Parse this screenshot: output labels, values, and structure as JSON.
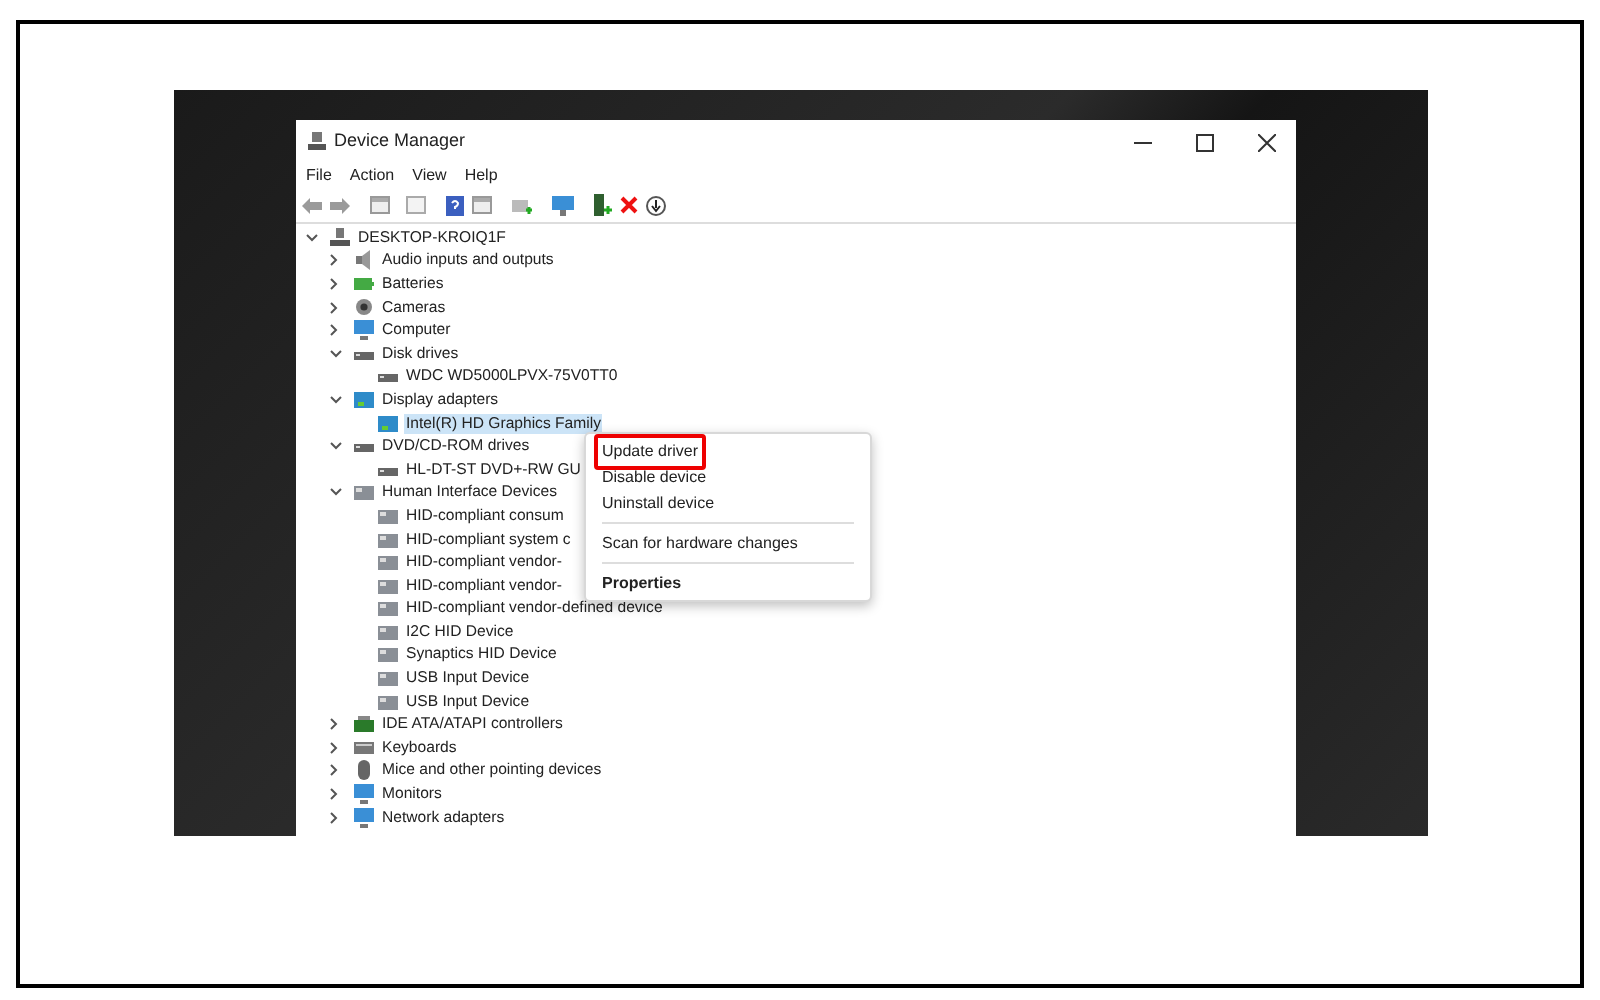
{
  "window": {
    "title": "Device Manager"
  },
  "menu_bar": [
    "File",
    "Action",
    "View",
    "Help"
  ],
  "tree": [
    {
      "label": "DESKTOP-KROIQ1F",
      "kind": "computer",
      "expanded": true,
      "selected": false,
      "children": [
        {
          "label": "Audio inputs and outputs",
          "kind": "audio",
          "expanded": false,
          "selected": false
        },
        {
          "label": "Batteries",
          "kind": "battery",
          "expanded": false,
          "selected": false
        },
        {
          "label": "Cameras",
          "kind": "camera",
          "expanded": false,
          "selected": false
        },
        {
          "label": "Computer",
          "kind": "monitor",
          "expanded": false,
          "selected": false
        },
        {
          "label": "Disk drives",
          "kind": "disk",
          "expanded": true,
          "selected": false,
          "children": [
            {
              "label": "WDC WD5000LPVX-75V0TT0",
              "kind": "disk",
              "selected": false
            }
          ]
        },
        {
          "label": "Display adapters",
          "kind": "display",
          "expanded": true,
          "selected": false,
          "children": [
            {
              "label": "Intel(R) HD Graphics Family",
              "kind": "display",
              "selected": true
            }
          ]
        },
        {
          "label": "DVD/CD-ROM drives",
          "kind": "disk",
          "expanded": true,
          "selected": false,
          "children": [
            {
              "label": "HL-DT-ST DVD+-RW GU",
              "kind": "disk",
              "selected": false
            }
          ]
        },
        {
          "label": "Human Interface Devices",
          "kind": "hid",
          "expanded": true,
          "selected": false,
          "children": [
            {
              "label": "HID-compliant consum",
              "kind": "hid",
              "selected": false
            },
            {
              "label": "HID-compliant system c",
              "kind": "hid",
              "selected": false
            },
            {
              "label": "HID-compliant vendor-",
              "kind": "hid",
              "selected": false
            },
            {
              "label": "HID-compliant vendor-",
              "kind": "hid",
              "selected": false
            },
            {
              "label": "HID-compliant vendor-defined device",
              "kind": "hid",
              "selected": false
            },
            {
              "label": "I2C HID Device",
              "kind": "hid",
              "selected": false
            },
            {
              "label": "Synaptics HID Device",
              "kind": "hid",
              "selected": false
            },
            {
              "label": "USB Input Device",
              "kind": "hid",
              "selected": false
            },
            {
              "label": "USB Input Device",
              "kind": "hid",
              "selected": false
            }
          ]
        },
        {
          "label": "IDE ATA/ATAPI controllers",
          "kind": "ide",
          "expanded": false,
          "selected": false
        },
        {
          "label": "Keyboards",
          "kind": "keyboard",
          "expanded": false,
          "selected": false
        },
        {
          "label": "Mice and other pointing devices",
          "kind": "mouse",
          "expanded": false,
          "selected": false
        },
        {
          "label": "Monitors",
          "kind": "monitor",
          "expanded": false,
          "selected": false
        },
        {
          "label": "Network adapters",
          "kind": "monitor",
          "expanded": false,
          "selected": false
        }
      ]
    }
  ],
  "context_menu": [
    {
      "label": "Update driver",
      "kind": "item",
      "highlighted": true
    },
    {
      "label": "Disable device",
      "kind": "item",
      "highlighted": false
    },
    {
      "label": "Uninstall device",
      "kind": "item",
      "highlighted": false
    },
    {
      "kind": "separator"
    },
    {
      "label": "Scan for hardware changes",
      "kind": "item",
      "highlighted": false
    },
    {
      "kind": "separator"
    },
    {
      "label": "Properties",
      "kind": "default",
      "highlighted": false
    }
  ]
}
